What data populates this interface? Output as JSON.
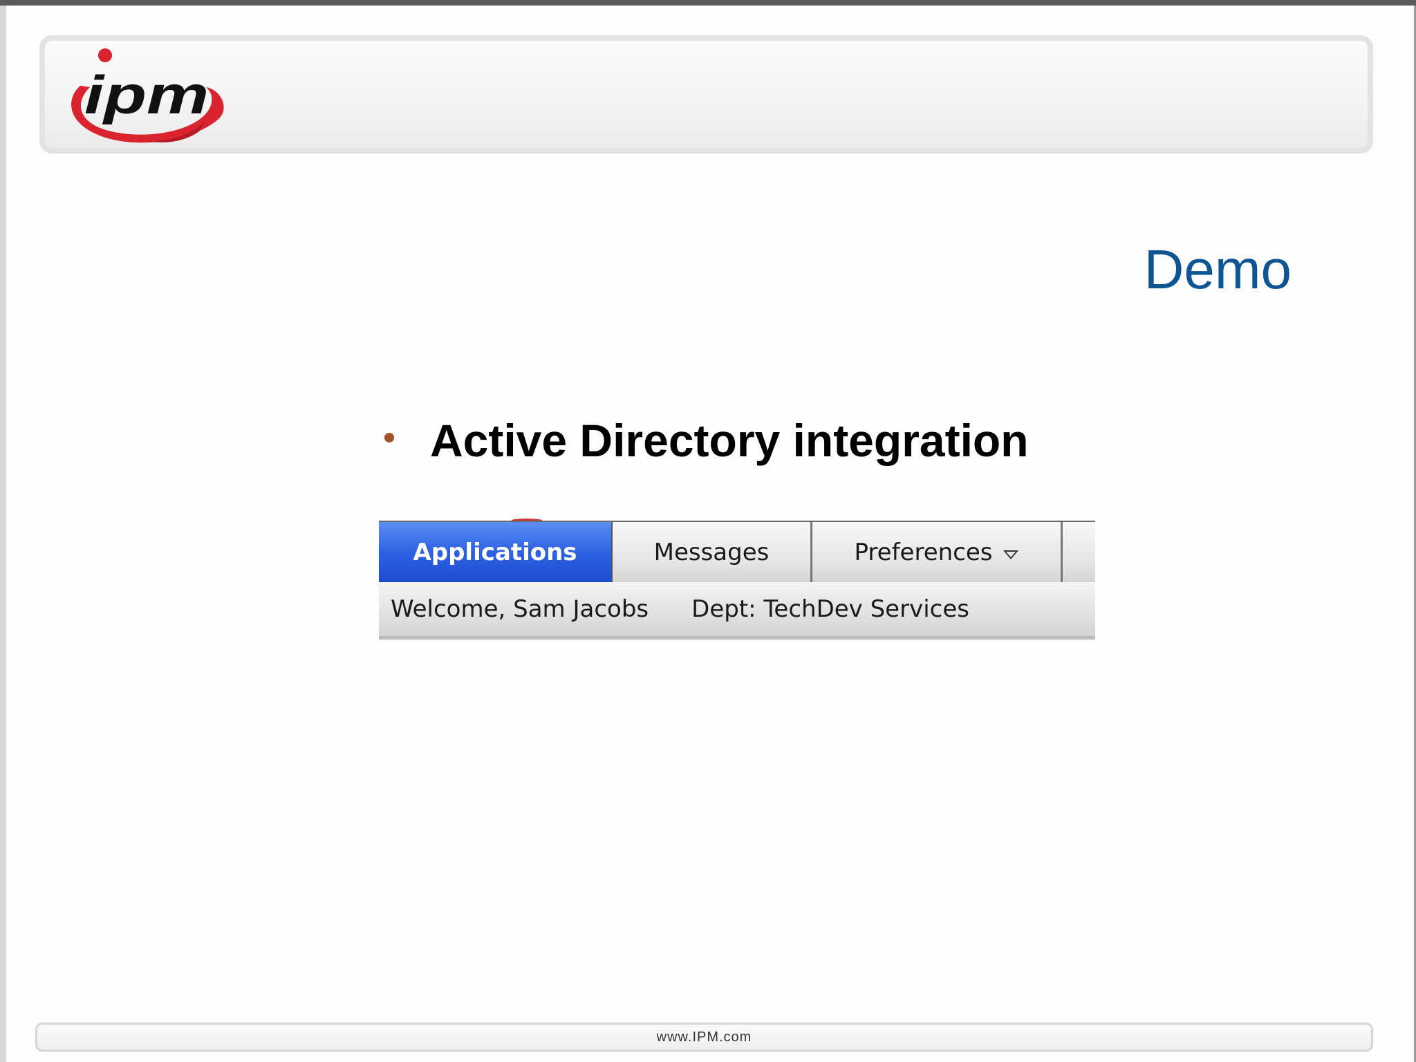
{
  "slide": {
    "logo_text": "ipm",
    "title": "Demo",
    "bullet": "Active Directory integration",
    "footer": "www.IPM.com"
  },
  "app_screenshot": {
    "tabs": [
      {
        "label": "Applications",
        "active": true
      },
      {
        "label": "Messages",
        "active": false
      },
      {
        "label": "Preferences",
        "active": false,
        "icon": "chevron-down-icon"
      }
    ],
    "welcome": "Welcome, Sam Jacobs",
    "department": "Dept: TechDev Services"
  },
  "colors": {
    "title": "#0e5594",
    "bullet": "#a0522d",
    "active_tab": "#2e62e3",
    "logo_red": "#d9232e"
  }
}
